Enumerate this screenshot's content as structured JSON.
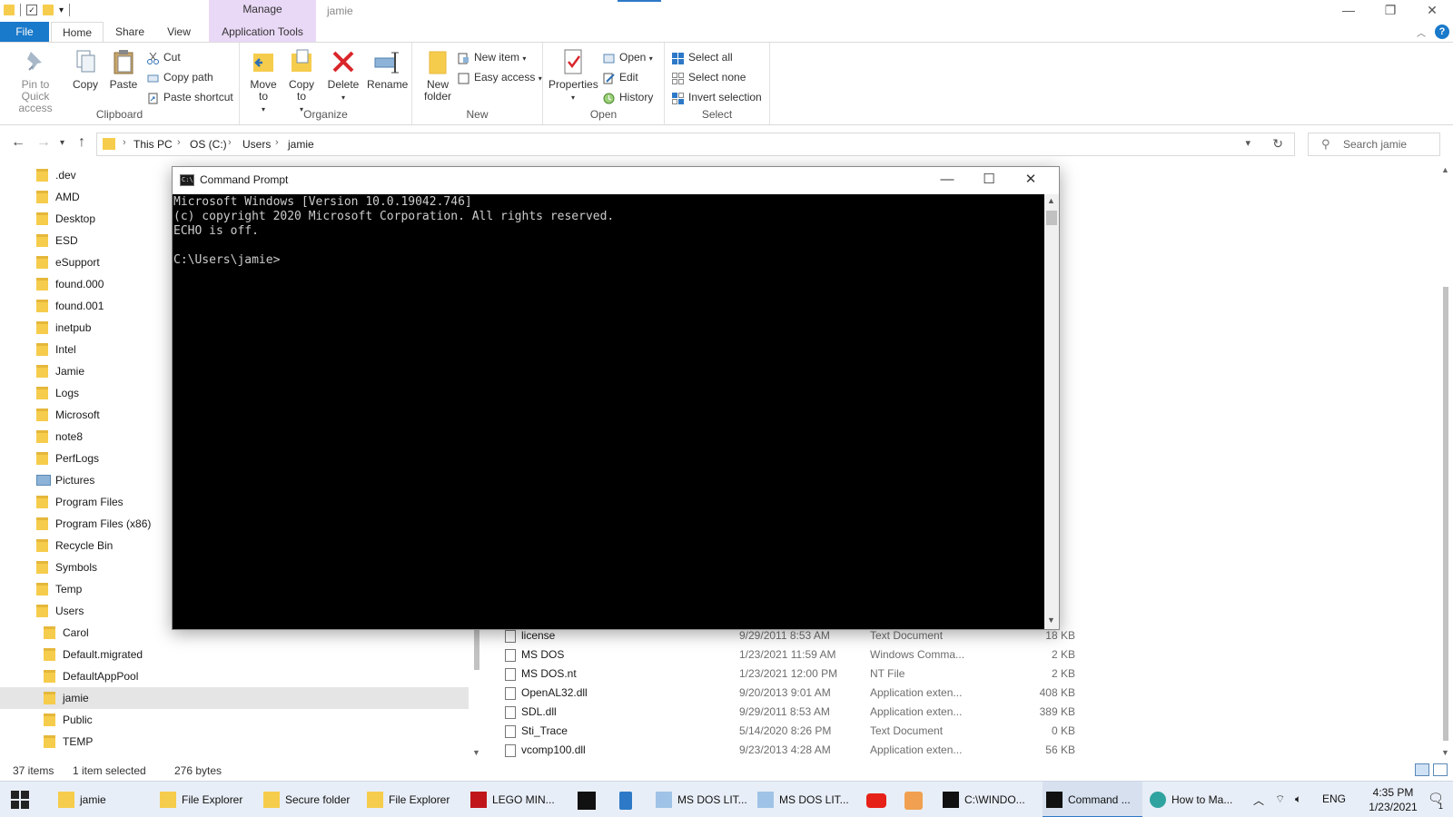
{
  "titlebar": {
    "manage_tab": "Manage",
    "window_title": "jamie",
    "controls": [
      "—",
      "❐",
      "✕"
    ]
  },
  "ribbon_tabs": {
    "file": "File",
    "home": "Home",
    "share": "Share",
    "view": "View",
    "app_tools": "Application Tools"
  },
  "ribbon": {
    "clipboard": {
      "label": "Clipboard",
      "pin": "Pin to Quick access",
      "copy": "Copy",
      "paste": "Paste",
      "cut": "Cut",
      "copy_path": "Copy path",
      "paste_shortcut": "Paste shortcut"
    },
    "organize": {
      "label": "Organize",
      "move_to": "Move to",
      "copy_to": "Copy to",
      "delete": "Delete",
      "rename": "Rename"
    },
    "new": {
      "label": "New",
      "new_folder": "New folder",
      "new_item": "New item",
      "easy_access": "Easy access"
    },
    "open": {
      "label": "Open",
      "properties": "Properties",
      "open": "Open",
      "edit": "Edit",
      "history": "History"
    },
    "select": {
      "label": "Select",
      "select_all": "Select all",
      "select_none": "Select none",
      "invert_selection": "Invert selection"
    }
  },
  "address": {
    "crumbs": [
      "This PC",
      "OS (C:)",
      "Users",
      "jamie"
    ],
    "search_placeholder": "Search jamie"
  },
  "nav_pane": {
    "items": [
      {
        "label": ".dev",
        "type": "folder",
        "indent": 0
      },
      {
        "label": "AMD",
        "type": "folder",
        "indent": 0
      },
      {
        "label": "Desktop",
        "type": "folder",
        "indent": 0
      },
      {
        "label": "ESD",
        "type": "folder",
        "indent": 0
      },
      {
        "label": "eSupport",
        "type": "folder",
        "indent": 0
      },
      {
        "label": "found.000",
        "type": "folder",
        "indent": 0
      },
      {
        "label": "found.001",
        "type": "folder",
        "indent": 0
      },
      {
        "label": "inetpub",
        "type": "folder",
        "indent": 0
      },
      {
        "label": "Intel",
        "type": "folder",
        "indent": 0
      },
      {
        "label": "Jamie",
        "type": "folder",
        "indent": 0
      },
      {
        "label": "Logs",
        "type": "folder",
        "indent": 0
      },
      {
        "label": "Microsoft",
        "type": "folder",
        "indent": 0
      },
      {
        "label": "note8",
        "type": "folder",
        "indent": 0
      },
      {
        "label": "PerfLogs",
        "type": "folder",
        "indent": 0
      },
      {
        "label": "Pictures",
        "type": "pictures",
        "indent": 0
      },
      {
        "label": "Program Files",
        "type": "folder",
        "indent": 0
      },
      {
        "label": "Program Files (x86)",
        "type": "folder",
        "indent": 0
      },
      {
        "label": "Recycle Bin",
        "type": "folder",
        "indent": 0
      },
      {
        "label": "Symbols",
        "type": "folder",
        "indent": 0
      },
      {
        "label": "Temp",
        "type": "folder",
        "indent": 0
      },
      {
        "label": "Users",
        "type": "folder",
        "indent": 0
      },
      {
        "label": "Carol",
        "type": "folder",
        "indent": 1
      },
      {
        "label": "Default.migrated",
        "type": "folder",
        "indent": 1
      },
      {
        "label": "DefaultAppPool",
        "type": "folder",
        "indent": 1
      },
      {
        "label": "jamie",
        "type": "folder",
        "indent": 1,
        "selected": true
      },
      {
        "label": "Public",
        "type": "folder",
        "indent": 1
      },
      {
        "label": "TEMP",
        "type": "folder",
        "indent": 1
      }
    ]
  },
  "files": [
    {
      "name": "license",
      "date": "9/29/2011 8:53 AM",
      "type": "Text Document",
      "size": "18 KB"
    },
    {
      "name": "MS DOS",
      "date": "1/23/2021 11:59 AM",
      "type": "Windows Comma...",
      "size": "2 KB"
    },
    {
      "name": "MS DOS.nt",
      "date": "1/23/2021 12:00 PM",
      "type": "NT File",
      "size": "2 KB"
    },
    {
      "name": "OpenAL32.dll",
      "date": "9/20/2013 9:01 AM",
      "type": "Application exten...",
      "size": "408 KB"
    },
    {
      "name": "SDL.dll",
      "date": "9/29/2011 8:53 AM",
      "type": "Application exten...",
      "size": "389 KB"
    },
    {
      "name": "Sti_Trace",
      "date": "5/14/2020 8:26 PM",
      "type": "Text Document",
      "size": "0 KB"
    },
    {
      "name": "vcomp100.dll",
      "date": "9/23/2013 4:28 AM",
      "type": "Application exten...",
      "size": "56 KB"
    }
  ],
  "status": {
    "items": "37 items",
    "selected": "1 item selected",
    "size": "276 bytes"
  },
  "cmd": {
    "title": "Command Prompt",
    "lines": [
      "Microsoft Windows [Version 10.0.19042.746]",
      "(c) copyright 2020 Microsoft Corporation. All rights reserved.",
      "ECHO is off.",
      "",
      "C:\\Users\\jamie>"
    ]
  },
  "taskbar": {
    "items": [
      {
        "label": "jamie",
        "icon": "folder-icon"
      },
      {
        "label": "File Explorer",
        "icon": "folder-icon"
      },
      {
        "label": "Secure folder",
        "icon": "folder-icon"
      },
      {
        "label": "File Explorer",
        "icon": "folder-icon"
      },
      {
        "label": "LEGO MIN...",
        "icon": "lego-app-icon"
      },
      {
        "label": "MS DOS LIT...",
        "icon": "notepad-icon"
      },
      {
        "label": "MS DOS LIT...",
        "icon": "notepad-icon"
      },
      {
        "label": "C:\\WINDO...",
        "icon": "cmd-icon"
      },
      {
        "label": "Command ...",
        "icon": "cmd-icon"
      },
      {
        "label": "How to Ma...",
        "icon": "edge-icon"
      }
    ],
    "lang": "ENG",
    "time": "4:35 PM",
    "date": "1/23/2021",
    "notification_count": "1"
  },
  "colors": {
    "accent": "#1979ca",
    "manage_tab": "#e9d8f6",
    "folder": "#f6cc4c",
    "delete_red": "#d9262b",
    "cmd_bg": "#000000",
    "cmd_text": "#cccccc"
  }
}
